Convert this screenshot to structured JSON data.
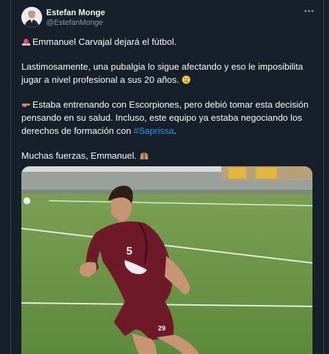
{
  "author": {
    "name": "Estefan Monge",
    "handle": "@EstefanMonge"
  },
  "more_icon": "more-horizontal-icon",
  "tweet": {
    "line1": "Emmanuel Carvajal dejará el fútbol.",
    "line2": "Lastimosamente, una pubalgia lo sigue afectando y eso le imposibilita",
    "line3": "jugar a nivel profesional a sus 20 años.",
    "line4": "Estaba entrenando con Escorpiones, pero debió tomar esta decisión",
    "line5": "pensando en su salud. Incluso, este equipo ya estaba negociando los",
    "line6_prefix": "derechos de formación con ",
    "line6_hashtag": "#Saprissa",
    "line6_suffix": ".",
    "line7": "Muchas fuerzas, Emmanuel."
  },
  "emojis": {
    "siren": "police-light-icon",
    "sad": "sad-face-icon",
    "pointing": "pointing-right-icon",
    "hands": "raising-hands-icon"
  },
  "photo": {
    "jersey_number": "5",
    "shorts_number": "29",
    "accent": "#7a1e2e"
  },
  "colors": {
    "background": "#15202b",
    "text": "#f7f9f9",
    "muted": "#8b98a5",
    "link": "#1d9bf0",
    "border": "#38444d"
  }
}
